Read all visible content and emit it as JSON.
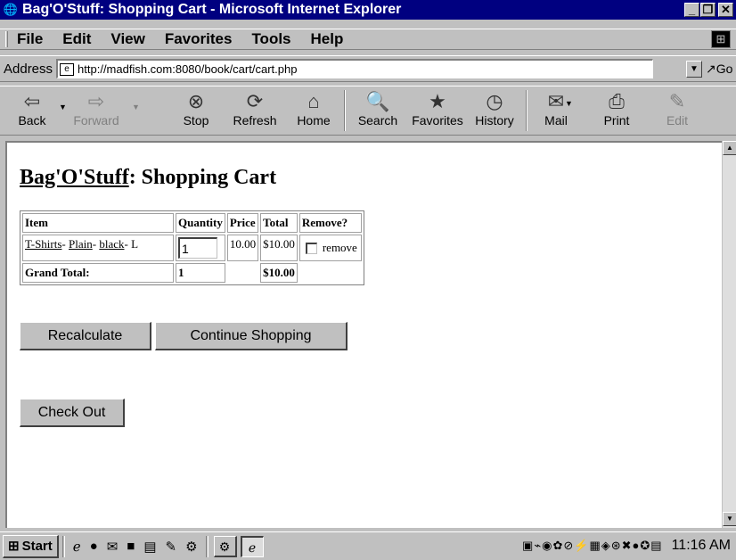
{
  "window": {
    "title": "Bag'O'Stuff: Shopping Cart - Microsoft Internet Explorer",
    "controls": {
      "minimize": "_",
      "maximize": "❐",
      "close": "✕"
    }
  },
  "menu": [
    "File",
    "Edit",
    "View",
    "Favorites",
    "Tools",
    "Help"
  ],
  "address": {
    "label": "Address",
    "url": "http://madfish.com:8080/book/cart/cart.php",
    "go_label": "Go"
  },
  "toolbar": {
    "back": "Back",
    "forward": "Forward",
    "stop": "Stop",
    "refresh": "Refresh",
    "home": "Home",
    "search": "Search",
    "favorites": "Favorites",
    "history": "History",
    "mail": "Mail",
    "print": "Print",
    "edit": "Edit"
  },
  "page": {
    "heading_link": "Bag'O'Stuff",
    "heading_rest": ": Shopping Cart",
    "table": {
      "headers": [
        "Item",
        "Quantity",
        "Price",
        "Total",
        "Remove?"
      ],
      "row": {
        "item_parts": [
          "T-Shirts",
          "Plain",
          "black"
        ],
        "item_sep": "- ",
        "item_size": "L",
        "quantity": "1",
        "price": "10.00",
        "total": "$10.00",
        "remove_label": "remove"
      },
      "grand_total_label": "Grand Total:",
      "grand_total_qty": "1",
      "grand_total_value": "$10.00"
    },
    "buttons": {
      "recalculate": "Recalculate",
      "continue": "Continue Shopping",
      "checkout": "Check Out"
    }
  },
  "taskbar": {
    "start": "Start",
    "clock": "11:16 AM"
  }
}
